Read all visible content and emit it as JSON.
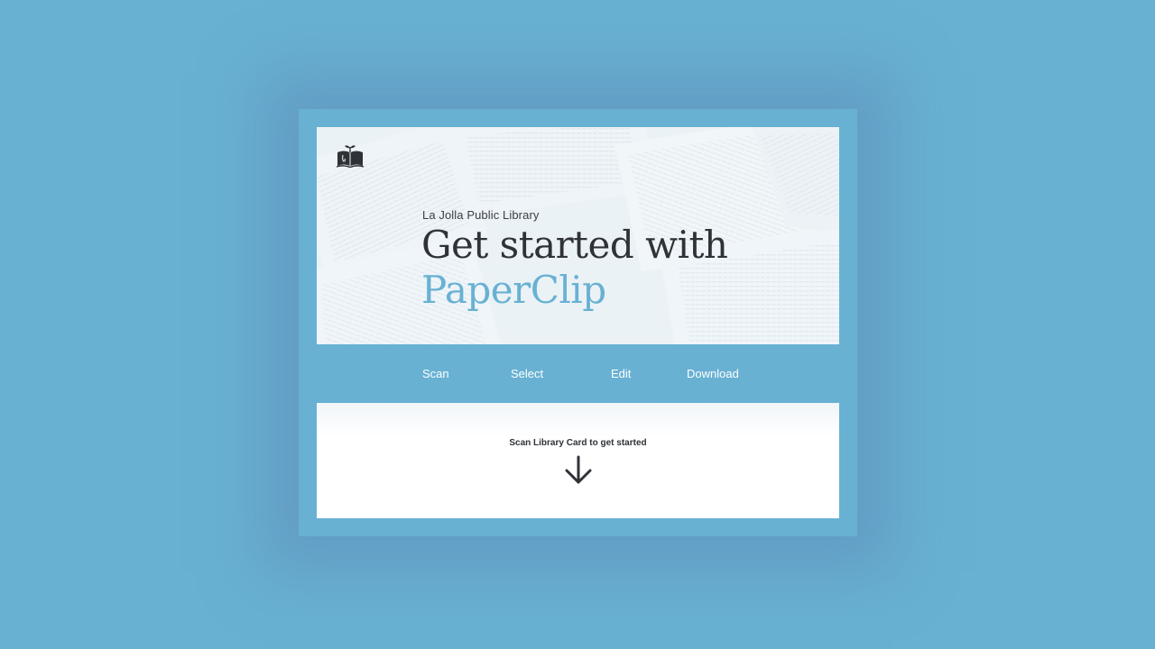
{
  "header": {
    "library_name": "La Jolla Public Library",
    "headline_line1": "Get started with",
    "headline_line2": "PaperClip",
    "logo_icon": "book-sprout-icon"
  },
  "steps": [
    {
      "label": "Scan"
    },
    {
      "label": "Select"
    },
    {
      "label": "Edit"
    },
    {
      "label": "Download"
    }
  ],
  "prompt": {
    "text": "Scan Library Card to get started",
    "icon": "arrow-down-icon"
  },
  "colors": {
    "background": "#68b1d3",
    "accent": "#68b1d3",
    "text_dark": "#2f3237",
    "step_text": "#ffffff"
  }
}
